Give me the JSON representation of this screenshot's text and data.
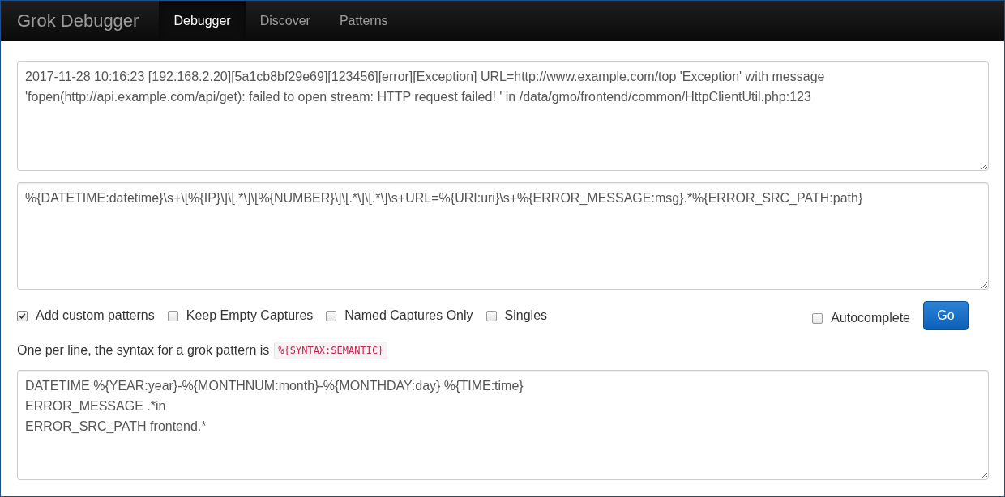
{
  "navbar": {
    "brand": "Grok Debugger",
    "tabs": [
      {
        "label": "Debugger",
        "selected": true
      },
      {
        "label": "Discover",
        "selected": false
      },
      {
        "label": "Patterns",
        "selected": false
      }
    ]
  },
  "sample_input": {
    "value": "2017-11-28 10:16:23 [192.168.2.20][5a1cb8bf29e69][123456][error][Exception] URL=http://www.example.com/top 'Exception' with message 'fopen(http://api.example.com/api/get): failed to open stream: HTTP request failed! ' in /data/gmo/frontend/common/HttpClientUtil.php:123"
  },
  "pattern_input": {
    "value": "%{DATETIME:datetime}\\s+\\[%{IP}\\]\\[.*\\]\\[%{NUMBER}\\]\\[.*\\]\\[.*\\]\\s+URL=%{URI:uri}\\s+%{ERROR_MESSAGE:msg}.*%{ERROR_SRC_PATH:path}"
  },
  "options": [
    {
      "label": "Add custom patterns",
      "checked": true
    },
    {
      "label": "Keep Empty Captures",
      "checked": false
    },
    {
      "label": "Named Captures Only",
      "checked": false
    },
    {
      "label": "Singles",
      "checked": false
    }
  ],
  "autocomplete": {
    "label": "Autocomplete",
    "checked": false
  },
  "go_button": "Go",
  "help": {
    "text": "One per line, the syntax for a grok pattern is",
    "code": "%{SYNTAX:SEMANTIC}"
  },
  "custom_patterns": {
    "value": "DATETIME %{YEAR:year}-%{MONTHNUM:month}-%{MONTHDAY:day} %{TIME:time}\nERROR_MESSAGE .*in\nERROR_SRC_PATH frontend.*"
  }
}
